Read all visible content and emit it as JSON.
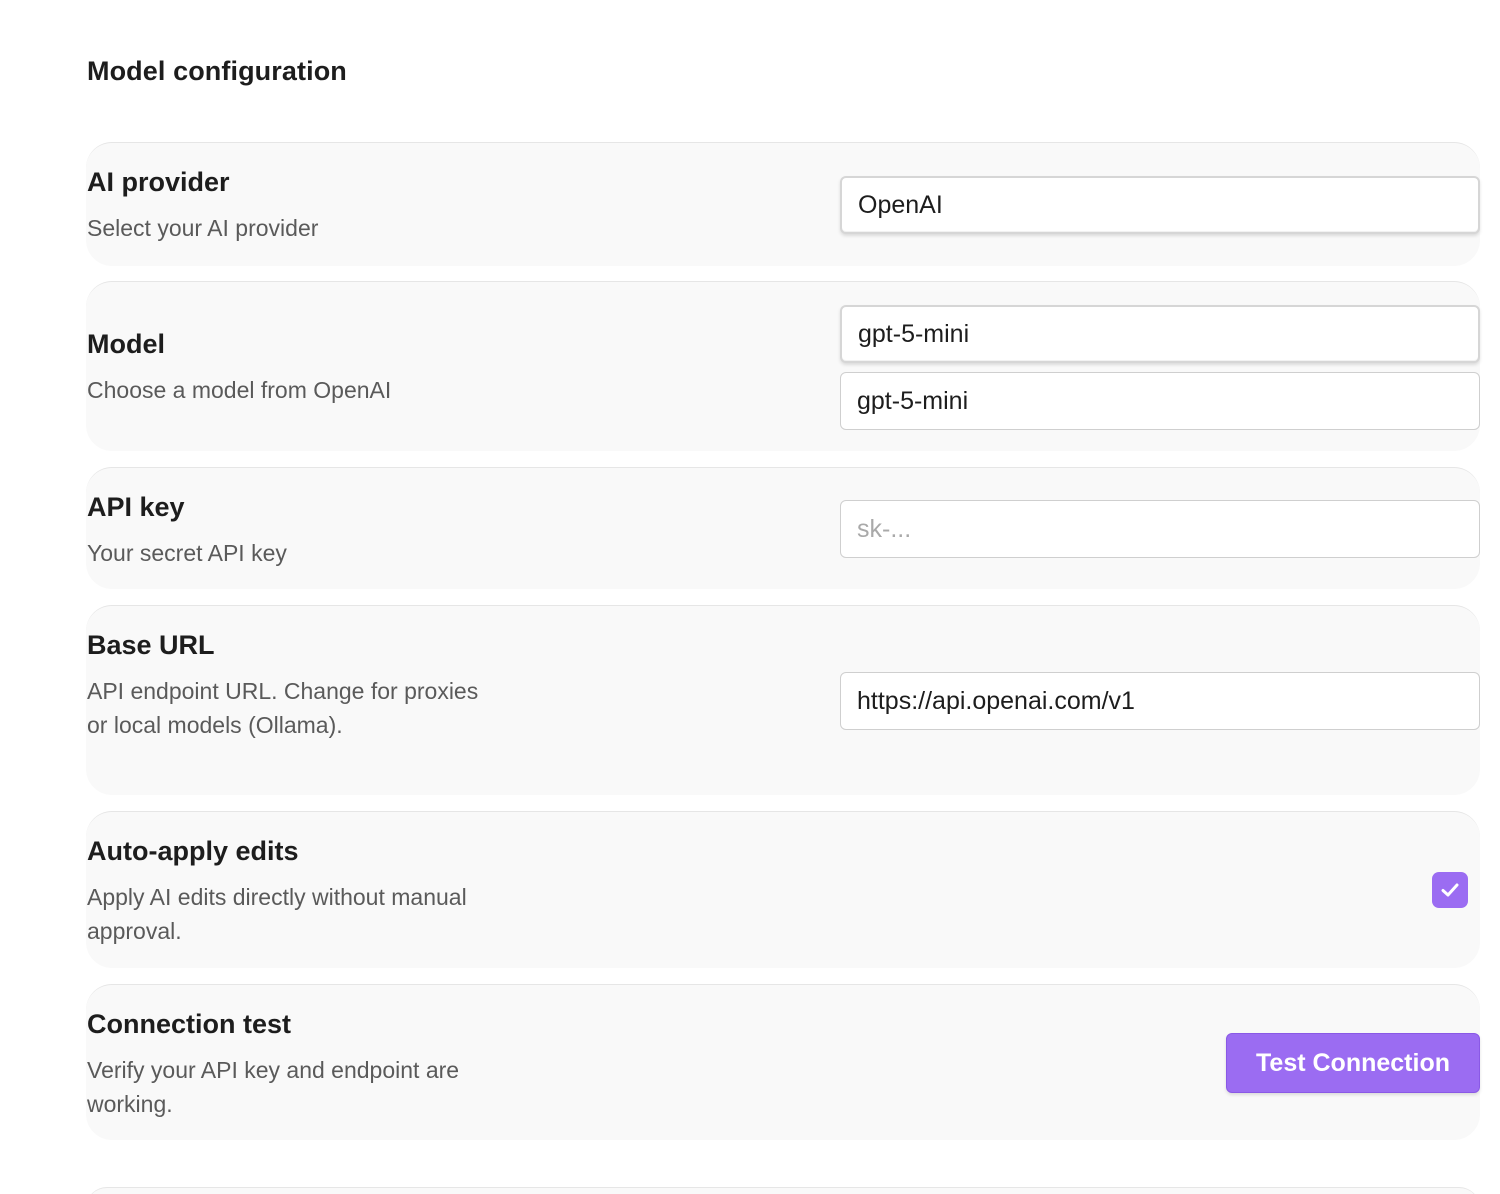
{
  "section": {
    "title": "Model configuration"
  },
  "provider": {
    "label": "AI provider",
    "description": "Select your AI provider",
    "value": "OpenAI"
  },
  "model": {
    "label": "Model",
    "description": "Choose a model from OpenAI",
    "select_value": "gpt-5-mini",
    "input_value": "gpt-5-mini"
  },
  "api_key": {
    "label": "API key",
    "description": "Your secret API key",
    "placeholder": "sk-..."
  },
  "base_url": {
    "label": "Base URL",
    "description": "API endpoint URL. Change for proxies or local models (Ollama).",
    "value": "https://api.openai.com/v1"
  },
  "auto_apply": {
    "label": "Auto-apply edits",
    "description": "Apply AI edits directly without manual approval.",
    "checked": true
  },
  "connection_test": {
    "label": "Connection test",
    "description": "Verify your API key and endpoint are working.",
    "button_label": "Test Connection"
  },
  "colors": {
    "accent": "#9b6cf2",
    "card_background": "#f9f9f9",
    "description_text": "#5a5a5a"
  },
  "icons": {
    "checkbox_mark": "check-icon"
  }
}
